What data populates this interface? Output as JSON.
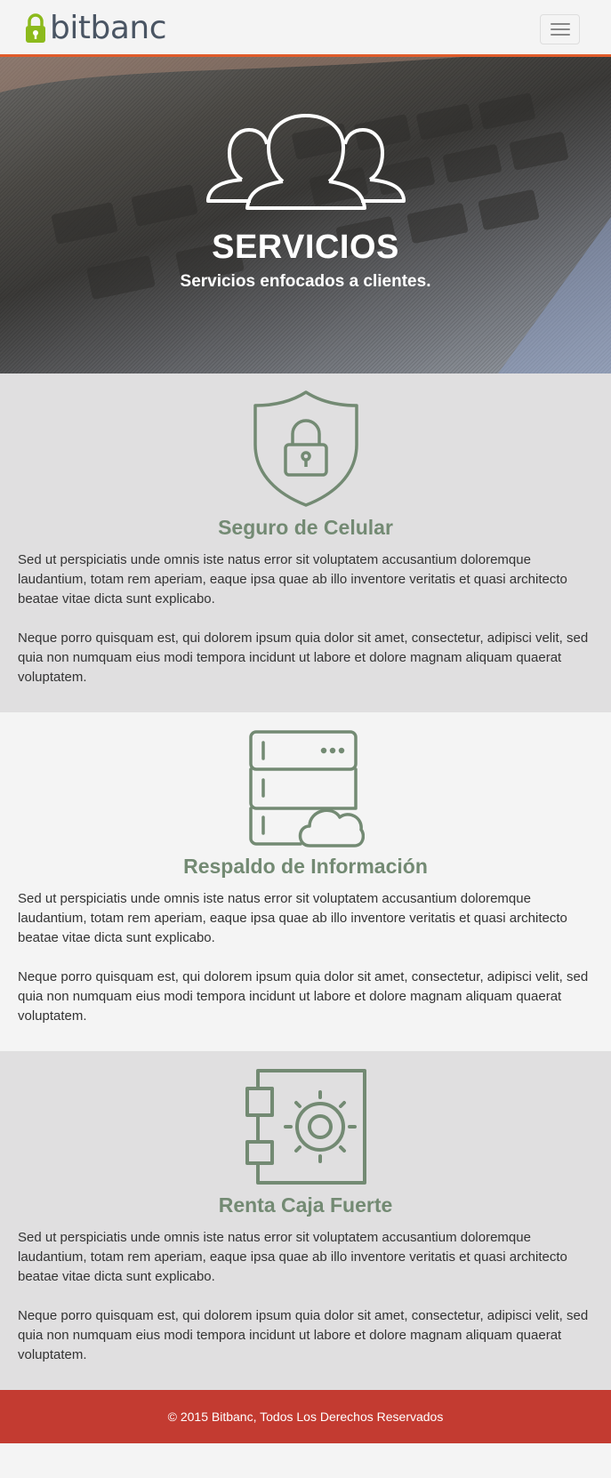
{
  "brand": {
    "name": "bitbanc",
    "logo_icon": "lock-icon",
    "logo_color": "#8cba1c"
  },
  "navbar": {
    "menu_icon": "hamburger-icon",
    "accent": "#e05b2a"
  },
  "hero": {
    "icon": "users-group-icon",
    "title": "SERVICIOS",
    "subtitle": "Servicios enfocados a clientes."
  },
  "services": [
    {
      "icon": "shield-lock-icon",
      "title": "Seguro de Celular",
      "paragraphs": [
        "Sed ut perspiciatis unde omnis iste natus error sit voluptatem accusantium doloremque laudantium, totam rem aperiam, eaque ipsa quae ab illo inventore veritatis et quasi architecto beatae vitae dicta sunt explicabo.",
        "Neque porro quisquam est, qui dolorem ipsum quia dolor sit amet, consectetur, adipisci velit, sed quia non numquam eius modi tempora incidunt ut labore et dolore magnam aliquam quaerat voluptatem."
      ]
    },
    {
      "icon": "server-cloud-icon",
      "title": "Respaldo de Información",
      "paragraphs": [
        "Sed ut perspiciatis unde omnis iste natus error sit voluptatem accusantium doloremque laudantium, totam rem aperiam, eaque ipsa quae ab illo inventore veritatis et quasi architecto beatae vitae dicta sunt explicabo.",
        "Neque porro quisquam est, qui dolorem ipsum quia dolor sit amet, consectetur, adipisci velit, sed quia non numquam eius modi tempora incidunt ut labore et dolore magnam aliquam quaerat voluptatem."
      ]
    },
    {
      "icon": "safe-icon",
      "title": "Renta Caja Fuerte",
      "paragraphs": [
        "Sed ut perspiciatis unde omnis iste natus error sit voluptatem accusantium doloremque laudantium, totam rem aperiam, eaque ipsa quae ab illo inventore veritatis et quasi architecto beatae vitae dicta sunt explicabo.",
        "Neque porro quisquam est, qui dolorem ipsum quia dolor sit amet, consectetur, adipisci velit, sed quia non numquam eius modi tempora incidunt ut labore et dolore magnam aliquam quaerat voluptatem."
      ]
    }
  ],
  "colors": {
    "service_title": "#738a73",
    "footer_bg": "#c33b31"
  },
  "footer": {
    "copyright": "© 2015 Bitbanc, Todos Los Derechos Reservados"
  }
}
